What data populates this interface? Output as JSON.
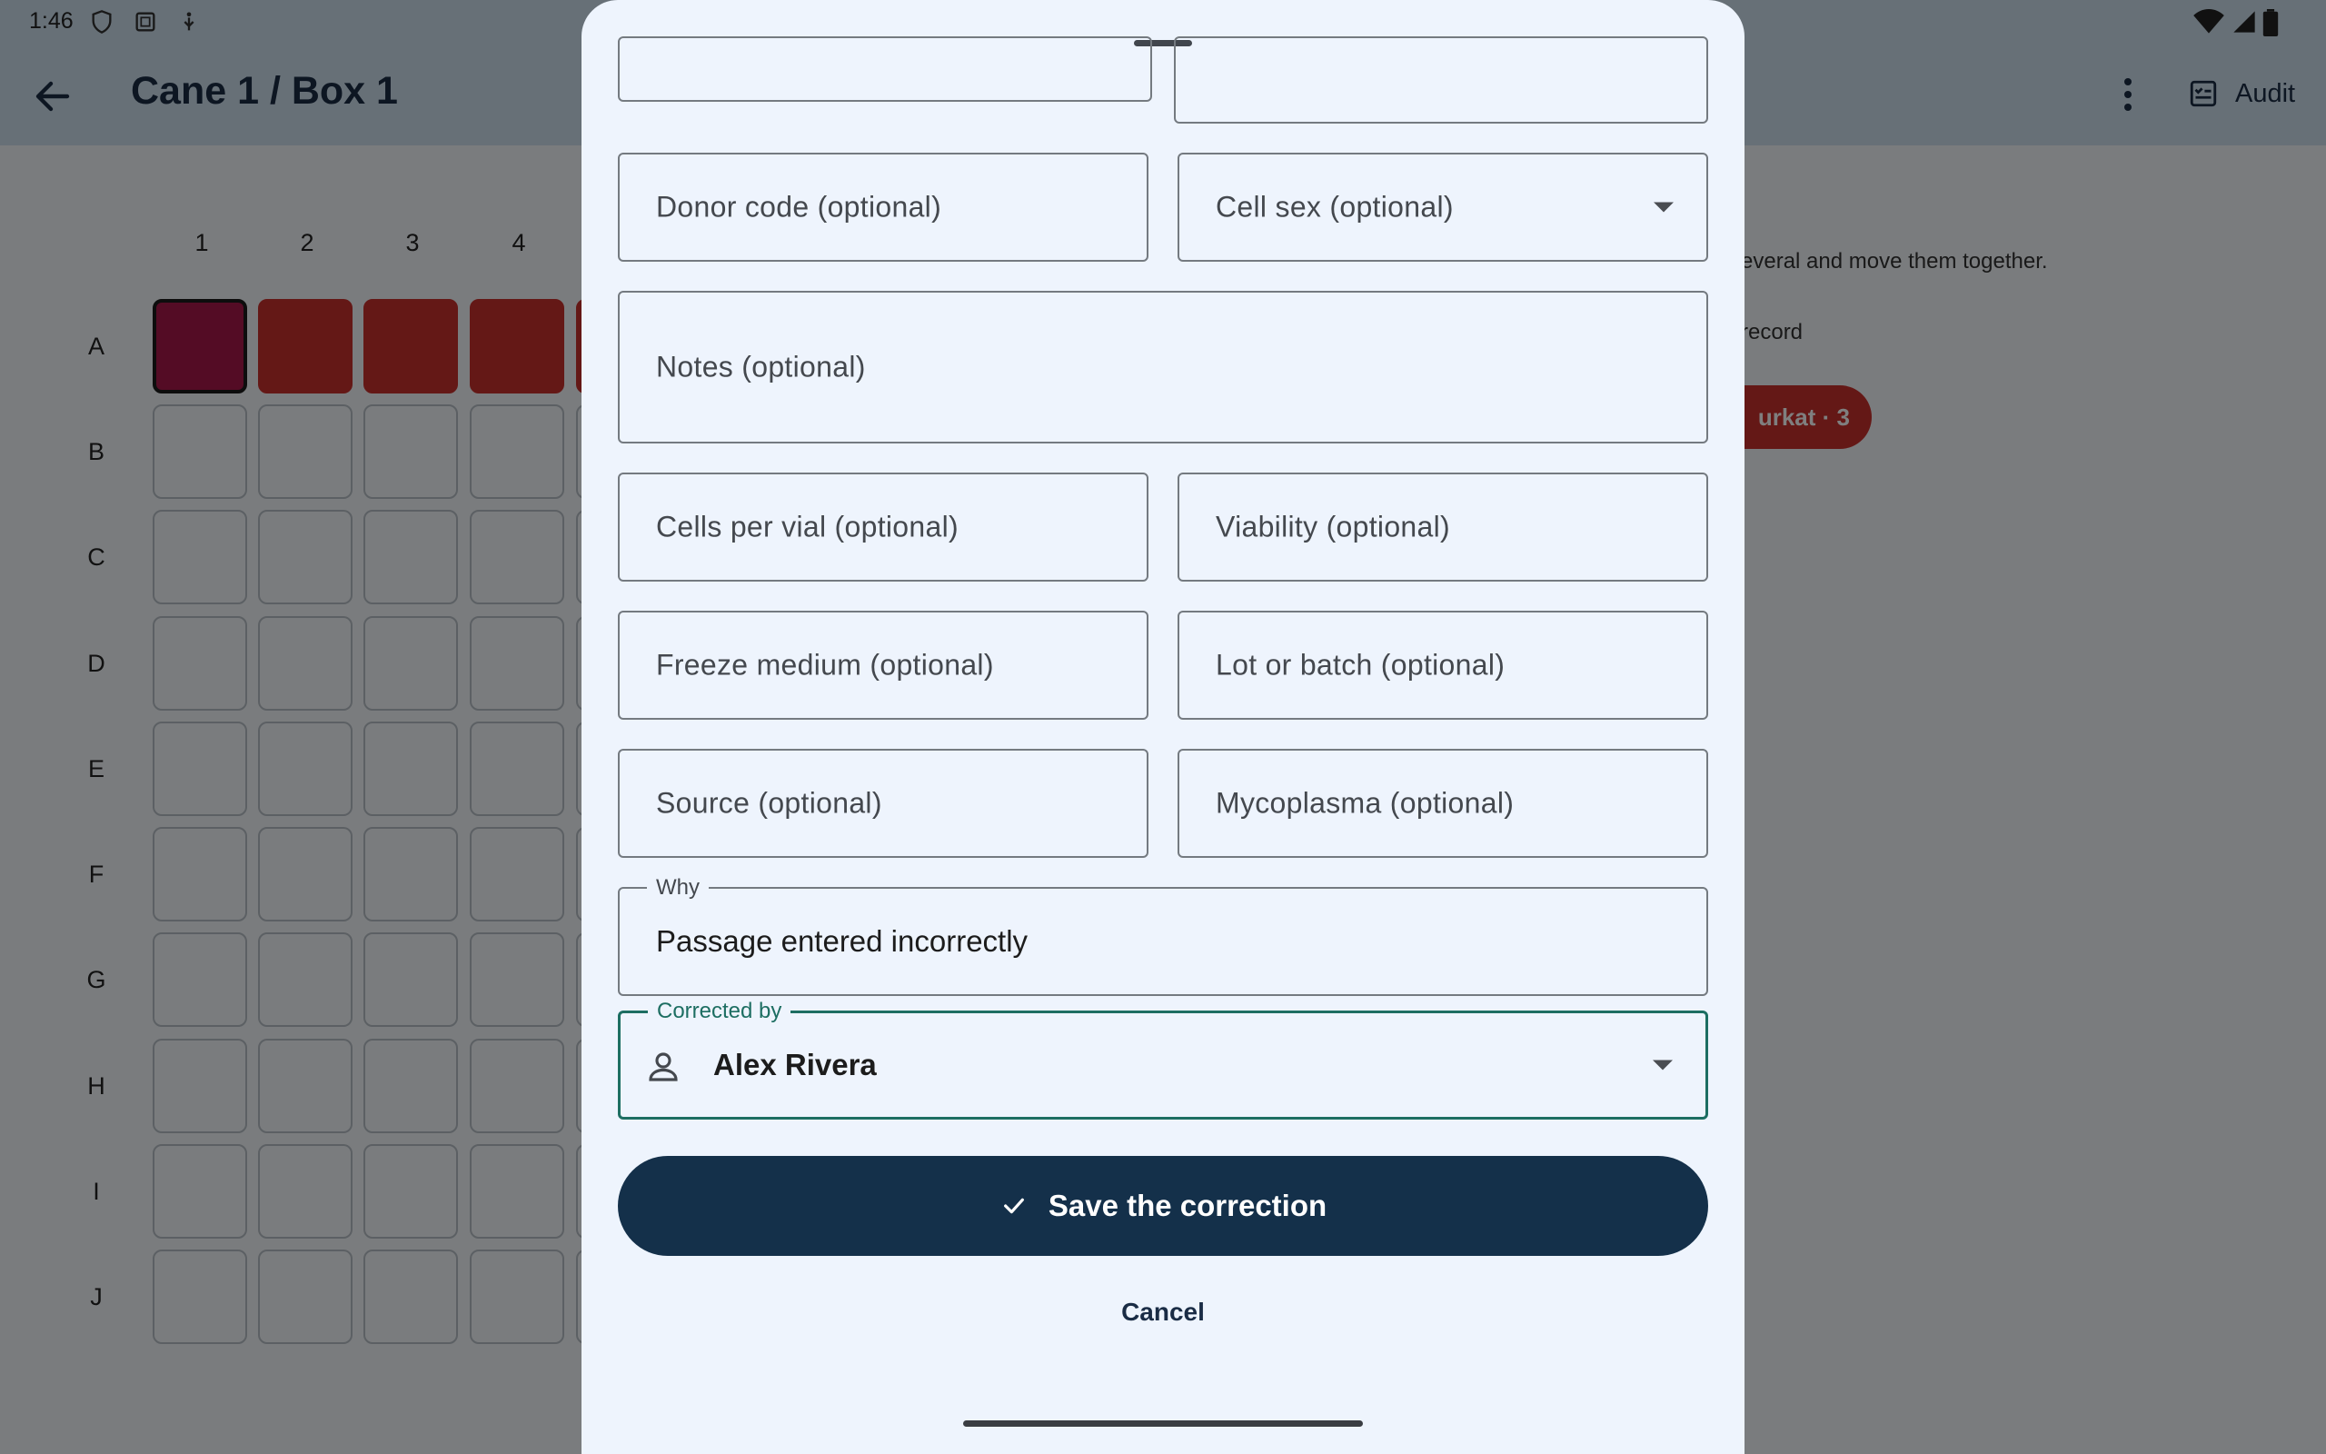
{
  "status_bar": {
    "time": "1:46"
  },
  "app_bar": {
    "title": "Cane 1 / Box 1",
    "audit_label": "Audit"
  },
  "grid": {
    "columns": [
      "1",
      "2",
      "3",
      "4"
    ],
    "rows": [
      "A",
      "B",
      "C",
      "D",
      "E",
      "F",
      "G",
      "H",
      "I",
      "J"
    ]
  },
  "side_panel": {
    "hint_text": "everal and move them together.",
    "record_text": "record",
    "chip_label": "urkat · 3"
  },
  "form": {
    "donor_code_placeholder": "Donor code (optional)",
    "cell_sex_placeholder": "Cell sex (optional)",
    "notes_placeholder": "Notes (optional)",
    "cells_per_vial_placeholder": "Cells per vial (optional)",
    "viability_placeholder": "Viability (optional)",
    "freeze_medium_placeholder": "Freeze medium (optional)",
    "lot_batch_placeholder": "Lot or batch (optional)",
    "source_placeholder": "Source (optional)",
    "mycoplasma_placeholder": "Mycoplasma (optional)",
    "why_label": "Why",
    "why_value": "Passage entered incorrectly",
    "corrected_by_label": "Corrected by",
    "corrected_by_value": "Alex Rivera",
    "save_label": "Save the correction",
    "cancel_label": "Cancel"
  },
  "colors": {
    "primary": "#14304a",
    "focus": "#1d6e62",
    "filled_cell": "#c9302c",
    "selected_cell": "#a8194a"
  }
}
